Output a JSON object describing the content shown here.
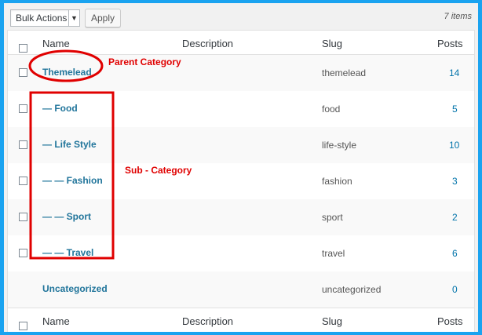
{
  "toolbar": {
    "bulk_actions": "Bulk Actions",
    "apply": "Apply",
    "items_count": "7 items"
  },
  "columns": {
    "name": "Name",
    "description": "Description",
    "slug": "Slug",
    "posts": "Posts"
  },
  "rows": [
    {
      "name": "Themelead",
      "description": "",
      "slug": "themelead",
      "posts": "14"
    },
    {
      "name": "— Food",
      "description": "",
      "slug": "food",
      "posts": "5"
    },
    {
      "name": "— Life Style",
      "description": "",
      "slug": "life-style",
      "posts": "10"
    },
    {
      "name": "— — Fashion",
      "description": "",
      "slug": "fashion",
      "posts": "3"
    },
    {
      "name": "— — Sport",
      "description": "",
      "slug": "sport",
      "posts": "2"
    },
    {
      "name": "— — Travel",
      "description": "",
      "slug": "travel",
      "posts": "6"
    },
    {
      "name": "Uncategorized",
      "description": "",
      "slug": "uncategorized",
      "posts": "0"
    }
  ],
  "annotations": {
    "parent": "Parent Category",
    "sub": "Sub - Category",
    "color": "#e00000"
  }
}
